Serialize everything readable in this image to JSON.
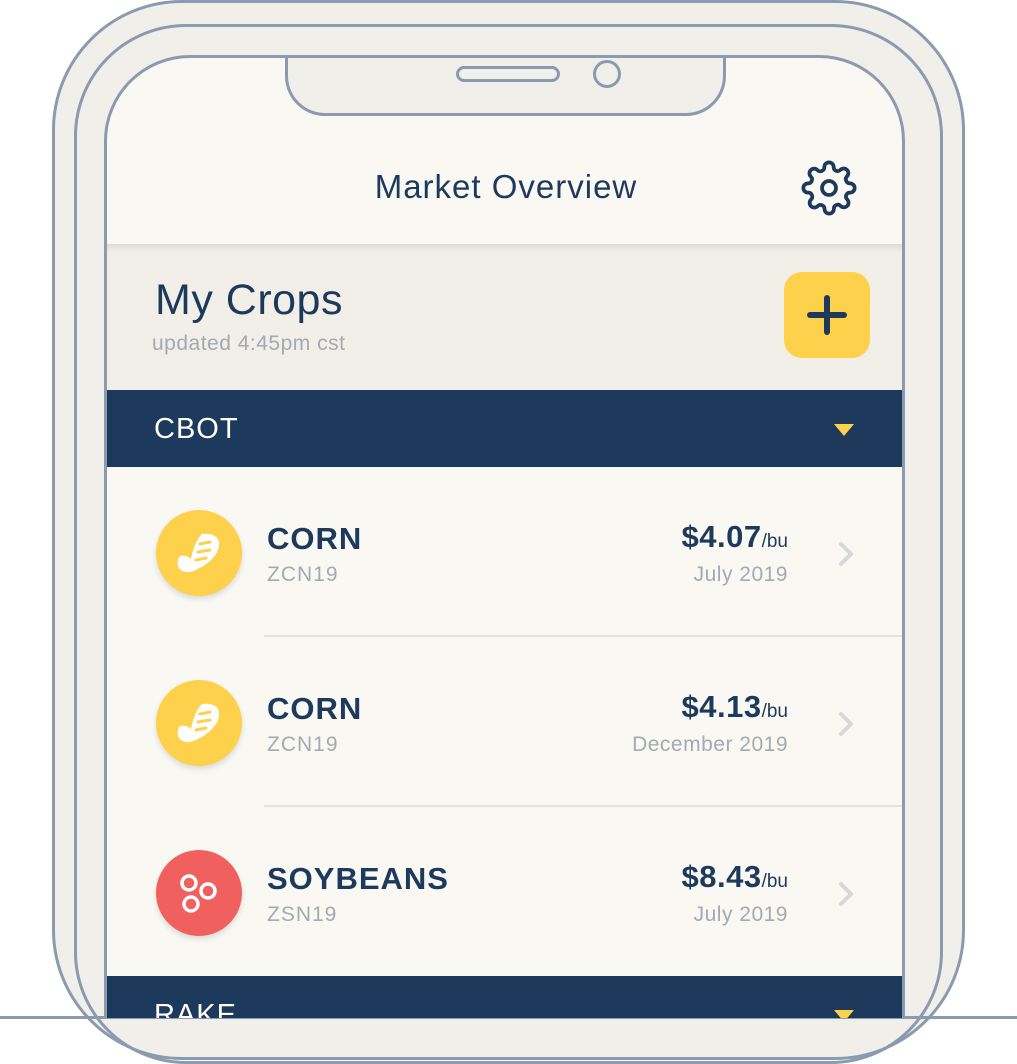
{
  "nav": {
    "title": "Market Overview",
    "settings_icon": "gear-icon"
  },
  "crops_header": {
    "title": "My Crops",
    "updated": "updated 4:45pm cst",
    "add_icon": "plus-icon"
  },
  "sections": [
    {
      "label": "CBOT",
      "items": [
        {
          "name": "CORN",
          "code": "ZCN19",
          "price": "$4.07",
          "unit": "/bu",
          "month": "July 2019",
          "icon": "corn-icon",
          "icon_color": "#fdd14b"
        },
        {
          "name": "CORN",
          "code": "ZCN19",
          "price": "$4.13",
          "unit": "/bu",
          "month": "December 2019",
          "icon": "corn-icon",
          "icon_color": "#fdd14b"
        },
        {
          "name": "SOYBEANS",
          "code": "ZSN19",
          "price": "$8.43",
          "unit": "/bu",
          "month": "July 2019",
          "icon": "soybeans-icon",
          "icon_color": "#f0605f"
        }
      ]
    },
    {
      "label": "RAKE",
      "items": []
    }
  ],
  "colors": {
    "navy": "#1d3a5c",
    "accent_yellow": "#fdd14b",
    "soy_red": "#f0605f",
    "muted_text": "#a3aab3",
    "screen_bg": "#faf8f2",
    "device_outline": "#8a9bb0"
  }
}
